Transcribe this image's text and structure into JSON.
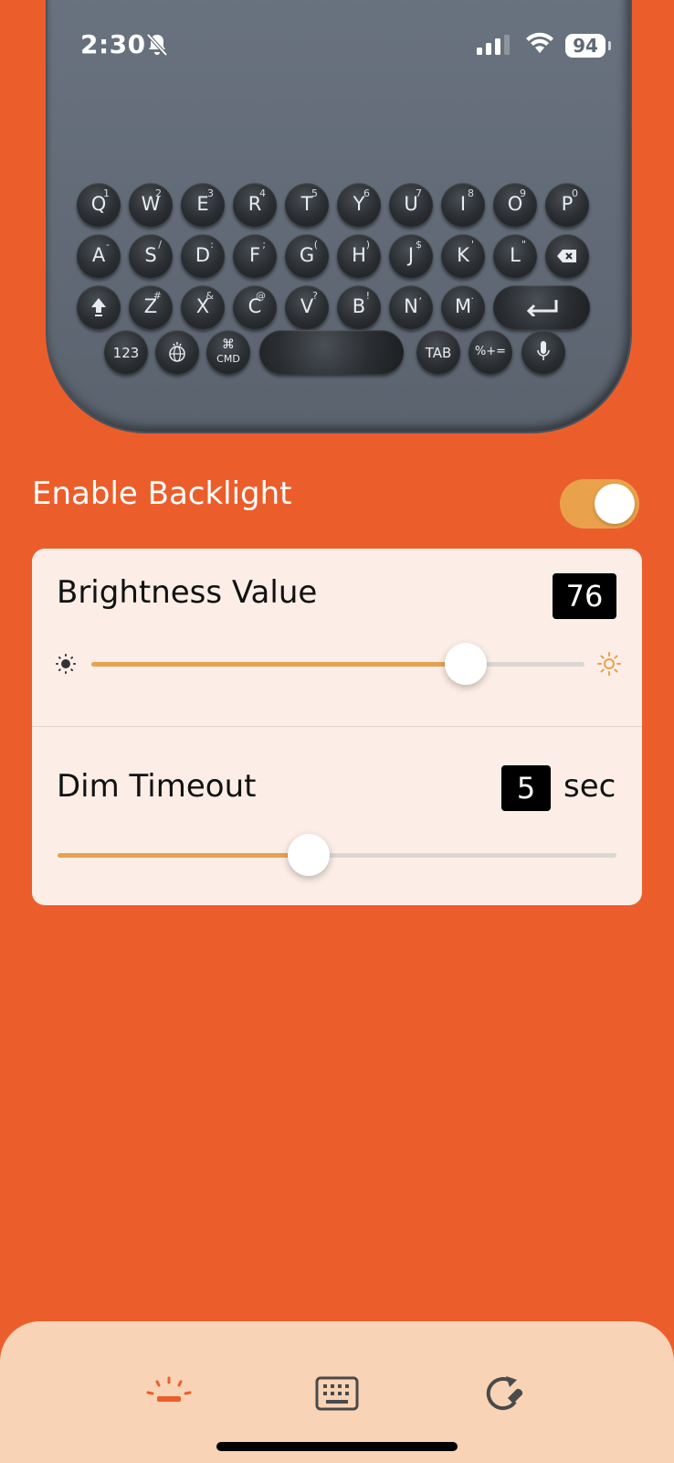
{
  "status_bar": {
    "time": "2:30",
    "battery": "94"
  },
  "keyboard": {
    "row1": [
      {
        "key": "Q",
        "sup": "1"
      },
      {
        "key": "W",
        "sup": "2"
      },
      {
        "key": "E",
        "sup": "3"
      },
      {
        "key": "R",
        "sup": "4"
      },
      {
        "key": "T",
        "sup": "5"
      },
      {
        "key": "Y",
        "sup": "6"
      },
      {
        "key": "U",
        "sup": "7"
      },
      {
        "key": "I",
        "sup": "8"
      },
      {
        "key": "O",
        "sup": "9"
      },
      {
        "key": "P",
        "sup": "0"
      }
    ],
    "row2": [
      {
        "key": "A",
        "sup": "-"
      },
      {
        "key": "S",
        "sup": "/"
      },
      {
        "key": "D",
        "sup": ":"
      },
      {
        "key": "F",
        "sup": ";"
      },
      {
        "key": "G",
        "sup": "("
      },
      {
        "key": "H",
        "sup": ")"
      },
      {
        "key": "J",
        "sup": "$"
      },
      {
        "key": "K",
        "sup": "'"
      },
      {
        "key": "L",
        "sup": "\""
      }
    ],
    "row3": [
      {
        "key": "Z",
        "sup": "#"
      },
      {
        "key": "X",
        "sup": "&"
      },
      {
        "key": "C",
        "sup": "@"
      },
      {
        "key": "V",
        "sup": "?"
      },
      {
        "key": "B",
        "sup": "!"
      },
      {
        "key": "N",
        "sup": ","
      },
      {
        "key": "M",
        "sup": "."
      }
    ],
    "numbers_key": "123",
    "cmd_symbol": "⌘",
    "cmd_label": "CMD",
    "tab_key": "TAB",
    "symbols_key": "%+="
  },
  "backlight": {
    "label": "Enable Backlight",
    "enabled": true
  },
  "brightness": {
    "label": "Brightness Value",
    "value": "76",
    "level_percent": 76
  },
  "dim_timeout": {
    "label": "Dim Timeout",
    "value": "5",
    "unit": "sec",
    "level_percent": 45
  },
  "tabs": [
    {
      "icon": "backlight-icon",
      "active": true
    },
    {
      "icon": "keyboard-icon",
      "active": false
    },
    {
      "icon": "update-tools-icon",
      "active": false
    }
  ],
  "colors": {
    "background": "#EB5E2B",
    "accent": "#E6A24E",
    "card": "#FCEEE6",
    "tab_bar": "#F8D3B6"
  }
}
